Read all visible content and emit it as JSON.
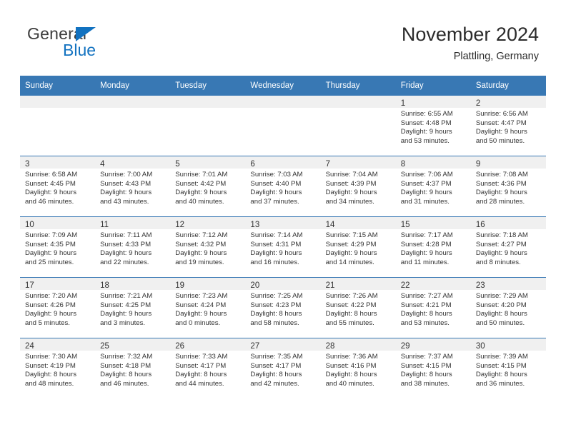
{
  "brand": {
    "name_part1": "General",
    "name_part2": "Blue",
    "accent_color": "#1272c0"
  },
  "header": {
    "title": "November 2024",
    "subtitle": "Plattling, Germany",
    "header_bg_color": "#3878b4"
  },
  "weekday_headers": [
    "Sunday",
    "Monday",
    "Tuesday",
    "Wednesday",
    "Thursday",
    "Friday",
    "Saturday"
  ],
  "labels": {
    "sunrise_prefix": "Sunrise:",
    "sunset_prefix": "Sunset:",
    "daylight_prefix": "Daylight:"
  },
  "weeks": [
    [
      {
        "day": "",
        "empty": true
      },
      {
        "day": "",
        "empty": true
      },
      {
        "day": "",
        "empty": true
      },
      {
        "day": "",
        "empty": true
      },
      {
        "day": "",
        "empty": true
      },
      {
        "day": "1",
        "sunrise": "Sunrise: 6:55 AM",
        "sunset": "Sunset: 4:48 PM",
        "daylight_line1": "Daylight: 9 hours",
        "daylight_line2": "and 53 minutes."
      },
      {
        "day": "2",
        "sunrise": "Sunrise: 6:56 AM",
        "sunset": "Sunset: 4:47 PM",
        "daylight_line1": "Daylight: 9 hours",
        "daylight_line2": "and 50 minutes."
      }
    ],
    [
      {
        "day": "3",
        "sunrise": "Sunrise: 6:58 AM",
        "sunset": "Sunset: 4:45 PM",
        "daylight_line1": "Daylight: 9 hours",
        "daylight_line2": "and 46 minutes."
      },
      {
        "day": "4",
        "sunrise": "Sunrise: 7:00 AM",
        "sunset": "Sunset: 4:43 PM",
        "daylight_line1": "Daylight: 9 hours",
        "daylight_line2": "and 43 minutes."
      },
      {
        "day": "5",
        "sunrise": "Sunrise: 7:01 AM",
        "sunset": "Sunset: 4:42 PM",
        "daylight_line1": "Daylight: 9 hours",
        "daylight_line2": "and 40 minutes."
      },
      {
        "day": "6",
        "sunrise": "Sunrise: 7:03 AM",
        "sunset": "Sunset: 4:40 PM",
        "daylight_line1": "Daylight: 9 hours",
        "daylight_line2": "and 37 minutes."
      },
      {
        "day": "7",
        "sunrise": "Sunrise: 7:04 AM",
        "sunset": "Sunset: 4:39 PM",
        "daylight_line1": "Daylight: 9 hours",
        "daylight_line2": "and 34 minutes."
      },
      {
        "day": "8",
        "sunrise": "Sunrise: 7:06 AM",
        "sunset": "Sunset: 4:37 PM",
        "daylight_line1": "Daylight: 9 hours",
        "daylight_line2": "and 31 minutes."
      },
      {
        "day": "9",
        "sunrise": "Sunrise: 7:08 AM",
        "sunset": "Sunset: 4:36 PM",
        "daylight_line1": "Daylight: 9 hours",
        "daylight_line2": "and 28 minutes."
      }
    ],
    [
      {
        "day": "10",
        "sunrise": "Sunrise: 7:09 AM",
        "sunset": "Sunset: 4:35 PM",
        "daylight_line1": "Daylight: 9 hours",
        "daylight_line2": "and 25 minutes."
      },
      {
        "day": "11",
        "sunrise": "Sunrise: 7:11 AM",
        "sunset": "Sunset: 4:33 PM",
        "daylight_line1": "Daylight: 9 hours",
        "daylight_line2": "and 22 minutes."
      },
      {
        "day": "12",
        "sunrise": "Sunrise: 7:12 AM",
        "sunset": "Sunset: 4:32 PM",
        "daylight_line1": "Daylight: 9 hours",
        "daylight_line2": "and 19 minutes."
      },
      {
        "day": "13",
        "sunrise": "Sunrise: 7:14 AM",
        "sunset": "Sunset: 4:31 PM",
        "daylight_line1": "Daylight: 9 hours",
        "daylight_line2": "and 16 minutes."
      },
      {
        "day": "14",
        "sunrise": "Sunrise: 7:15 AM",
        "sunset": "Sunset: 4:29 PM",
        "daylight_line1": "Daylight: 9 hours",
        "daylight_line2": "and 14 minutes."
      },
      {
        "day": "15",
        "sunrise": "Sunrise: 7:17 AM",
        "sunset": "Sunset: 4:28 PM",
        "daylight_line1": "Daylight: 9 hours",
        "daylight_line2": "and 11 minutes."
      },
      {
        "day": "16",
        "sunrise": "Sunrise: 7:18 AM",
        "sunset": "Sunset: 4:27 PM",
        "daylight_line1": "Daylight: 9 hours",
        "daylight_line2": "and 8 minutes."
      }
    ],
    [
      {
        "day": "17",
        "sunrise": "Sunrise: 7:20 AM",
        "sunset": "Sunset: 4:26 PM",
        "daylight_line1": "Daylight: 9 hours",
        "daylight_line2": "and 5 minutes."
      },
      {
        "day": "18",
        "sunrise": "Sunrise: 7:21 AM",
        "sunset": "Sunset: 4:25 PM",
        "daylight_line1": "Daylight: 9 hours",
        "daylight_line2": "and 3 minutes."
      },
      {
        "day": "19",
        "sunrise": "Sunrise: 7:23 AM",
        "sunset": "Sunset: 4:24 PM",
        "daylight_line1": "Daylight: 9 hours",
        "daylight_line2": "and 0 minutes."
      },
      {
        "day": "20",
        "sunrise": "Sunrise: 7:25 AM",
        "sunset": "Sunset: 4:23 PM",
        "daylight_line1": "Daylight: 8 hours",
        "daylight_line2": "and 58 minutes."
      },
      {
        "day": "21",
        "sunrise": "Sunrise: 7:26 AM",
        "sunset": "Sunset: 4:22 PM",
        "daylight_line1": "Daylight: 8 hours",
        "daylight_line2": "and 55 minutes."
      },
      {
        "day": "22",
        "sunrise": "Sunrise: 7:27 AM",
        "sunset": "Sunset: 4:21 PM",
        "daylight_line1": "Daylight: 8 hours",
        "daylight_line2": "and 53 minutes."
      },
      {
        "day": "23",
        "sunrise": "Sunrise: 7:29 AM",
        "sunset": "Sunset: 4:20 PM",
        "daylight_line1": "Daylight: 8 hours",
        "daylight_line2": "and 50 minutes."
      }
    ],
    [
      {
        "day": "24",
        "sunrise": "Sunrise: 7:30 AM",
        "sunset": "Sunset: 4:19 PM",
        "daylight_line1": "Daylight: 8 hours",
        "daylight_line2": "and 48 minutes."
      },
      {
        "day": "25",
        "sunrise": "Sunrise: 7:32 AM",
        "sunset": "Sunset: 4:18 PM",
        "daylight_line1": "Daylight: 8 hours",
        "daylight_line2": "and 46 minutes."
      },
      {
        "day": "26",
        "sunrise": "Sunrise: 7:33 AM",
        "sunset": "Sunset: 4:17 PM",
        "daylight_line1": "Daylight: 8 hours",
        "daylight_line2": "and 44 minutes."
      },
      {
        "day": "27",
        "sunrise": "Sunrise: 7:35 AM",
        "sunset": "Sunset: 4:17 PM",
        "daylight_line1": "Daylight: 8 hours",
        "daylight_line2": "and 42 minutes."
      },
      {
        "day": "28",
        "sunrise": "Sunrise: 7:36 AM",
        "sunset": "Sunset: 4:16 PM",
        "daylight_line1": "Daylight: 8 hours",
        "daylight_line2": "and 40 minutes."
      },
      {
        "day": "29",
        "sunrise": "Sunrise: 7:37 AM",
        "sunset": "Sunset: 4:15 PM",
        "daylight_line1": "Daylight: 8 hours",
        "daylight_line2": "and 38 minutes."
      },
      {
        "day": "30",
        "sunrise": "Sunrise: 7:39 AM",
        "sunset": "Sunset: 4:15 PM",
        "daylight_line1": "Daylight: 8 hours",
        "daylight_line2": "and 36 minutes."
      }
    ]
  ]
}
